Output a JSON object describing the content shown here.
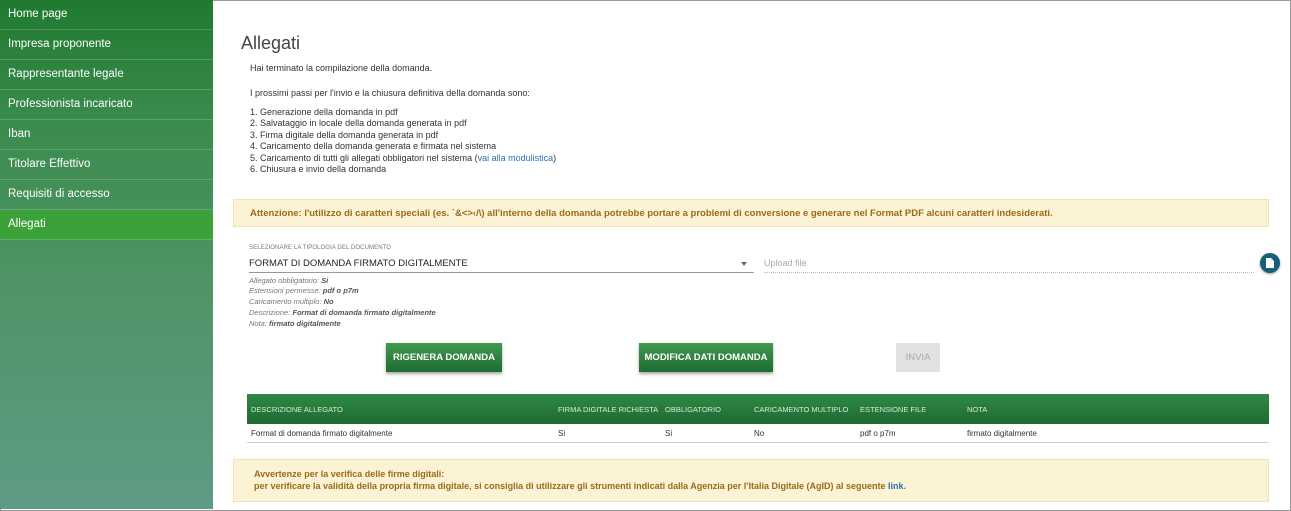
{
  "sidebar": {
    "items": [
      {
        "label": "Home page",
        "active": false
      },
      {
        "label": "Impresa proponente",
        "active": false
      },
      {
        "label": "Rappresentante legale",
        "active": false
      },
      {
        "label": "Professionista incaricato",
        "active": false
      },
      {
        "label": "Iban",
        "active": false
      },
      {
        "label": "Titolare Effettivo",
        "active": false
      },
      {
        "label": "Requisiti di accesso",
        "active": false
      },
      {
        "label": "Allegati",
        "active": true
      }
    ]
  },
  "main": {
    "title": "Allegati",
    "intro": "Hai terminato la compilazione della domanda.",
    "steps_intro": "I prossimi passi per l'invio e la chiusura definitiva della domanda sono:",
    "steps": [
      "1. Generazione della domanda in pdf",
      "2. Salvataggio in locale della domanda generata in pdf",
      "3. Firma digitale della domanda generata in pdf",
      "4. Caricamento della domanda generata e firmata nel sistema",
      "5. Caricamento di tutti gli allegati obbligatori nel sistema (",
      "6. Chiusura e invio della domanda"
    ],
    "step5_link": "vai alla modulistica",
    "step5_end": ")",
    "warning": "Attenzione: l'utilizzo di caratteri speciali (es. `&<>‹/\\) all'interno della domanda potrebbe portare a problemi di conversione e generare nel Format PDF alcuni caratteri indesiderati.",
    "select": {
      "label": "SELEZIONARE LA TIPOLOGIA DEL DOCUMENTO",
      "value": "FORMAT DI DOMANDA FIRMATO DIGITALMENTE"
    },
    "upload": {
      "placeholder": "Upload file"
    },
    "meta": [
      {
        "key": "Allegato obbligatorio:",
        "value": "Si"
      },
      {
        "key": "Estensioni permesse:",
        "value": "pdf o p7m"
      },
      {
        "key": "Caricamento multiplo:",
        "value": "No"
      },
      {
        "key": "Descrizione:",
        "value": "Format di domanda firmato digitalmente"
      },
      {
        "key": "Nota:",
        "value": "firmato digitalmente"
      }
    ],
    "buttons": {
      "regenerate": "RIGENERA DOMANDA",
      "edit": "MODIFICA DATI DOMANDA",
      "send": "INVIA"
    },
    "table": {
      "headers": [
        "DESCRIZIONE ALLEGATO",
        "FIRMA DIGITALE RICHIESTA",
        "OBBLIGATORIO",
        "CARICAMENTO MULTIPLO",
        "ESTENSIONE FILE",
        "NOTA"
      ],
      "rows": [
        [
          "Format di domanda firmato digitalmente",
          "Si",
          "Si",
          "No",
          "pdf o p7m",
          "firmato digitalmente"
        ]
      ]
    },
    "notice": {
      "title": "Avvertenze per la verifica delle firme digitali:",
      "text": "per verificare la validità della propria firma digitale, si consiglia di utilizzare gli strumenti indicati dalla Agenzia per l'Italia Digitale (AgID) al seguente ",
      "link": "link",
      "end": "."
    }
  }
}
